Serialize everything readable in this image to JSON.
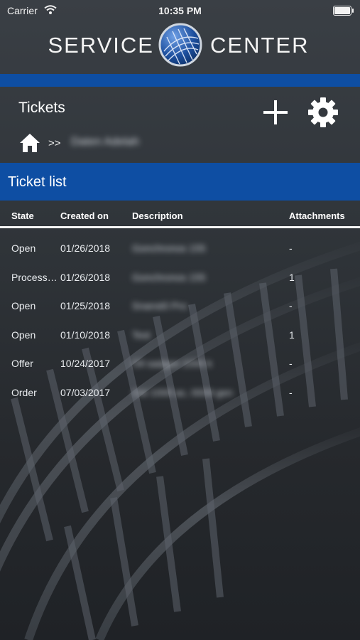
{
  "status_bar": {
    "carrier": "Carrier",
    "time": "10:35 PM",
    "wifi_icon": "wifi-icon",
    "battery_icon": "battery-icon"
  },
  "brand": {
    "left_text": "SERVICE",
    "right_text": "CENTER",
    "logo_icon": "globe-logo-icon",
    "accent_color": "#0e4ea3"
  },
  "page": {
    "title": "Tickets",
    "add_icon": "plus-icon",
    "settings_icon": "gear-icon"
  },
  "breadcrumb": {
    "home_icon": "home-icon",
    "separator": ">>",
    "current": "Daten Adelah"
  },
  "ticket_list": {
    "title": "Ticket list",
    "columns": {
      "state": "State",
      "created_on": "Created on",
      "description": "Description",
      "attachments": "Attachments"
    },
    "rows": [
      {
        "state": "Open",
        "created_on": "01/26/2018",
        "description": "Gonchronos 155",
        "attachments": "-"
      },
      {
        "state": "Processing",
        "created_on": "01/26/2018",
        "description": "Gonchronos 155",
        "attachments": "1"
      },
      {
        "state": "Open",
        "created_on": "01/25/2018",
        "description": "Snanst0 Pro",
        "attachments": "-"
      },
      {
        "state": "Open",
        "created_on": "01/10/2018",
        "description": "Test",
        "attachments": "1"
      },
      {
        "state": "Offer",
        "created_on": "10/24/2017",
        "description": "Oil sadgen 1000 k",
        "attachments": "-"
      },
      {
        "state": "Order",
        "created_on": "07/03/2017",
        "description": "Ost 1000 ac, 0009 gen",
        "attachments": "-"
      }
    ]
  }
}
